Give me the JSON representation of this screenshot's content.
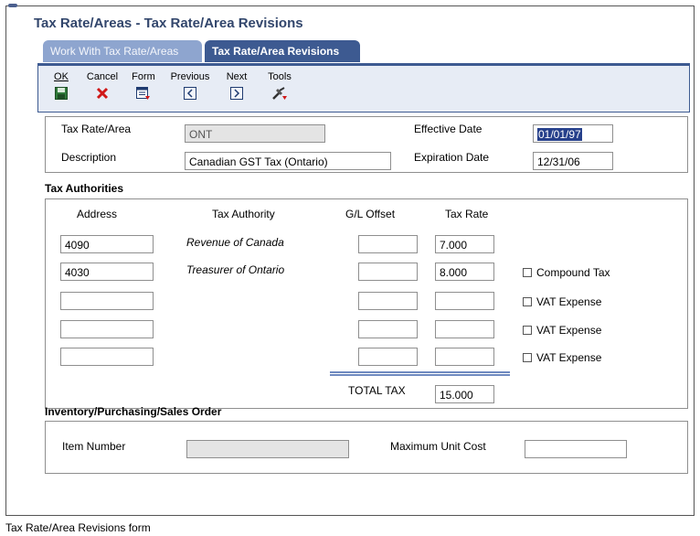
{
  "window": {
    "title": "Tax Rate/Areas - Tax Rate/Area Revisions"
  },
  "tabs": [
    {
      "label": "Work With Tax Rate/Areas"
    },
    {
      "label": "Tax Rate/Area Revisions"
    }
  ],
  "toolbar": {
    "ok": "OK",
    "cancel": "Cancel",
    "form": "Form",
    "previous": "Previous",
    "next": "Next",
    "tools": "Tools"
  },
  "header": {
    "tax_rate_area_label": "Tax Rate/Area",
    "tax_rate_area_value": "ONT",
    "description_label": "Description",
    "description_value": "Canadian GST Tax (Ontario)",
    "effective_date_label": "Effective Date",
    "effective_date_value": "01/01/97",
    "expiration_date_label": "Expiration Date",
    "expiration_date_value": "12/31/06"
  },
  "tax_authorities": {
    "title": "Tax Authorities",
    "col_address": "Address",
    "col_tax_authority": "Tax Authority",
    "col_gl_offset": "G/L Offset",
    "col_tax_rate": "Tax Rate",
    "rows": [
      {
        "address": "4090",
        "authority": "Revenue of Canada",
        "gl_offset": "",
        "rate": "7.000",
        "checkbox": ""
      },
      {
        "address": "4030",
        "authority": "Treasurer of Ontario",
        "gl_offset": "",
        "rate": "8.000",
        "checkbox": "Compound Tax"
      },
      {
        "address": "",
        "authority": "",
        "gl_offset": "",
        "rate": "",
        "checkbox": "VAT Expense"
      },
      {
        "address": "",
        "authority": "",
        "gl_offset": "",
        "rate": "",
        "checkbox": "VAT Expense"
      },
      {
        "address": "",
        "authority": "",
        "gl_offset": "",
        "rate": "",
        "checkbox": "VAT Expense"
      }
    ],
    "total_tax_label": "TOTAL TAX",
    "total_tax_value": "15.000"
  },
  "inventory": {
    "title": "Inventory/Purchasing/Sales Order",
    "item_number_label": "Item Number",
    "item_number_value": "",
    "max_unit_cost_label": "Maximum Unit Cost",
    "max_unit_cost_value": ""
  },
  "caption": "Tax Rate/Area Revisions form"
}
